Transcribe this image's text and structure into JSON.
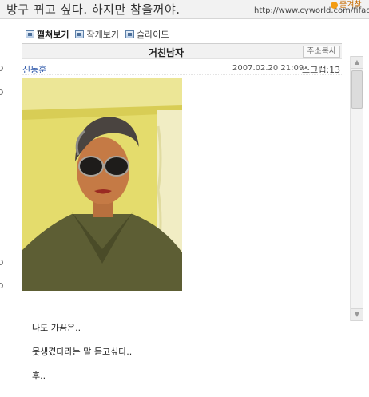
{
  "window": {
    "title": "방구 뀌고 싶다. 하지만 참을꺼야.",
    "url": "http://www.cyworld.com/fifaonli",
    "badge": "즐겨찾"
  },
  "view_tabs": [
    {
      "label": "펼쳐보기",
      "active": true
    },
    {
      "label": "작게보기",
      "active": false
    },
    {
      "label": "슬라이드",
      "active": false
    }
  ],
  "post": {
    "title": "거친남자",
    "copy_button": "주소복사",
    "author": "신동훈",
    "date": "2007.02.20 21:09",
    "scrap": "스크랩:13",
    "body_lines": [
      "나도 가끔은..",
      "못생겼다라는 말 듣고싶다..",
      "후.."
    ]
  },
  "icons": {
    "tab_icon": "photo-view-icon",
    "badge_icon": "favorite-icon"
  },
  "colors": {
    "author_link": "#2a55a8",
    "header_bg": "#f1f1f1",
    "photo_wall": "#e3da6a"
  }
}
